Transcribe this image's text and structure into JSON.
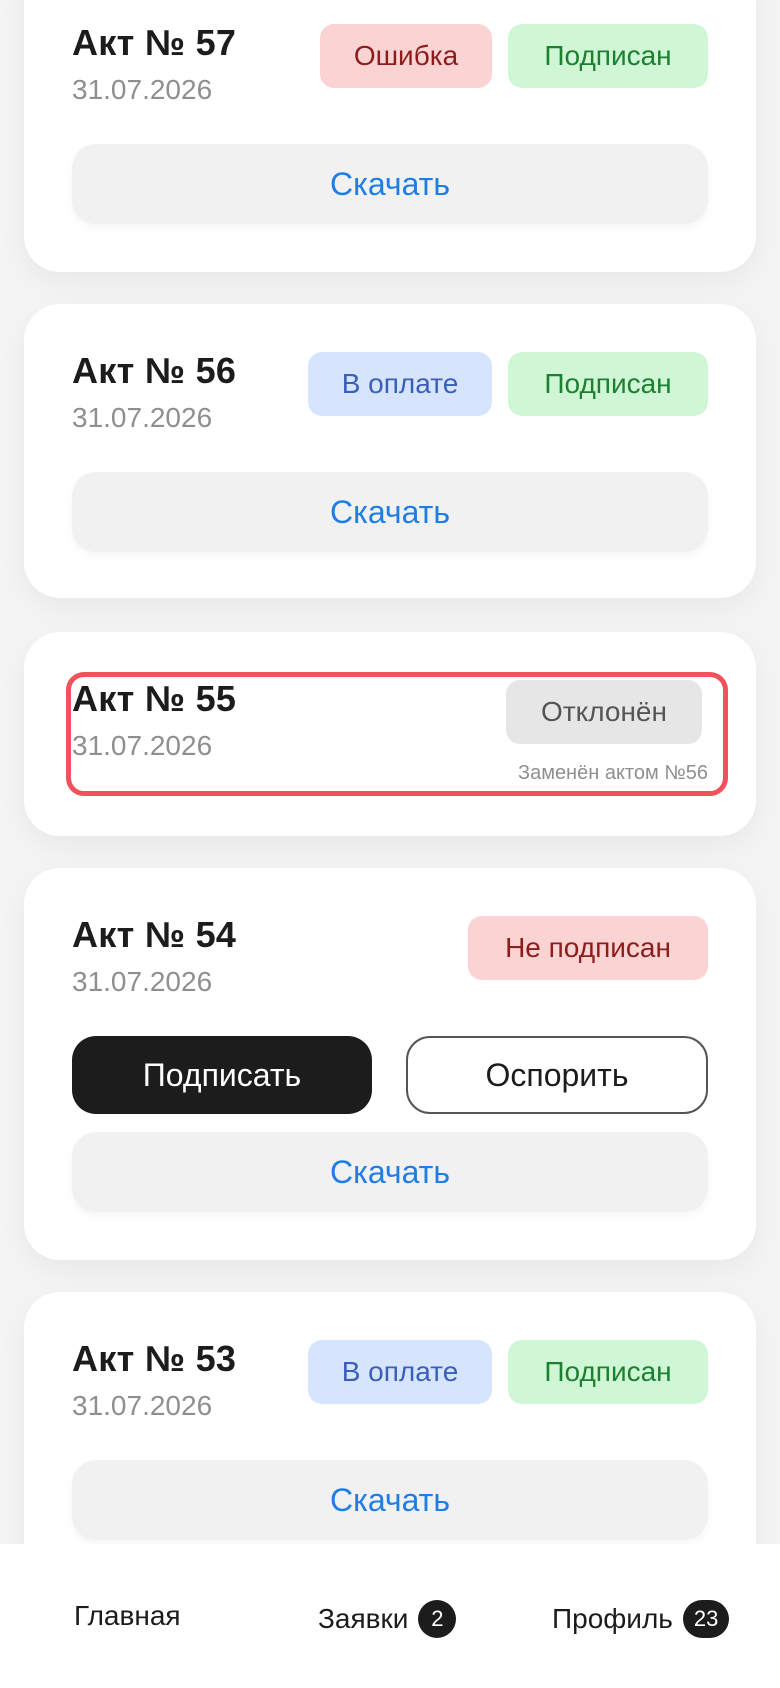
{
  "acts": [
    {
      "title": "Акт № 57",
      "date": "31.07.2026",
      "badges": [
        "Ошибка",
        "Подписан"
      ],
      "download": "Скачать"
    },
    {
      "title": "Акт № 56",
      "date": "31.07.2026",
      "badges": [
        "В оплате",
        "Подписан"
      ],
      "download": "Скачать"
    },
    {
      "title": "Акт № 55",
      "date": "31.07.2026",
      "badges": [
        "Отклонён"
      ],
      "note": "Заменён актом №56"
    },
    {
      "title": "Акт № 54",
      "date": "31.07.2026",
      "badges": [
        "Не подписан"
      ],
      "sign": "Подписать",
      "dispute": "Оспорить",
      "download": "Скачать"
    },
    {
      "title": "Акт № 53",
      "date": "31.07.2026",
      "badges": [
        "В оплате",
        "Подписан"
      ],
      "download": "Скачать"
    }
  ],
  "nav": {
    "home": "Главная",
    "requests": "Заявки",
    "requests_count": "2",
    "profile": "Профиль",
    "profile_count": "23"
  },
  "colors": {
    "accent": "#1e7de6",
    "error_bg": "#fcd3d3",
    "signed_bg": "#cff7d6",
    "pay_bg": "#d6e5fd",
    "rejected_bg": "#e6e6e6",
    "highlight_border": "#f0515a"
  }
}
